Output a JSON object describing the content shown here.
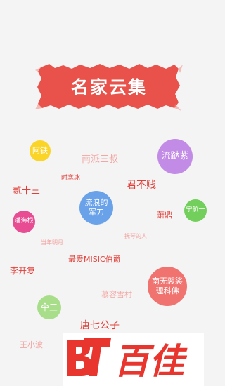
{
  "title": "名家云集",
  "bubbles": {
    "a_tie": "阿铁",
    "liu_zhi_zi": "流跶紫",
    "liu_lang_line1": "流浪的",
    "liu_lang_line2": "军刀",
    "ning_hang_yi": "宁航一",
    "pan_hai_gen": "潘海根",
    "nan_wu_line1": "南无袈裟",
    "nan_wu_line2": "理科佛",
    "ge_san": "仐三"
  },
  "words": {
    "nan_pai_san_shu": "南派三叔",
    "shi_han_bing": "时寒冰",
    "er_shi_san": "贰十三",
    "jun_bu_jian": "君不贱",
    "xiao_ding": "萧鼎",
    "fu_qin_de_ren": "抚琴的人",
    "dang_nian_ming_yue": "当年明月",
    "li_kai_fu": "李开复",
    "zui_ai_music": "最爱MISIC伯爵",
    "mu_rong_xue_cun": "慕容雪村",
    "tang_qi_gong_zi": "唐七公子",
    "wang_xiao_bo": "王小波"
  },
  "logo": {
    "text": "百佳"
  },
  "colors": {
    "banner_red": "#e9524a",
    "bubble_yellow": "#fbd428",
    "bubble_purple": "#c28be6",
    "bubble_blue": "#6aa2ea",
    "bubble_green": "#73cf5b",
    "bubble_pink": "#e84c93",
    "bubble_coral": "#f07370",
    "bubble_lightgreen": "#a8de8a",
    "logo_red": "#e8362e"
  }
}
